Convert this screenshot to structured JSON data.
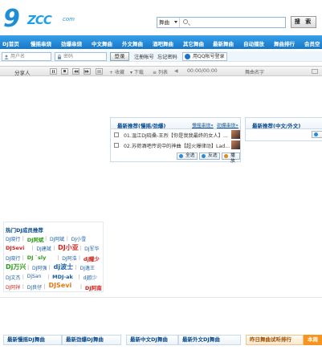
{
  "header": {
    "logo": {
      "mark": "9",
      "name": "ZCC",
      "suffix": "com"
    },
    "search": {
      "category": "舞曲",
      "placeholder": "",
      "button": "搜 索"
    }
  },
  "nav": {
    "items": [
      "DJ首页",
      "慢摇串烧",
      "劲爆串烧",
      "中文舞曲",
      "外文舞曲",
      "酒吧舞曲",
      "其它舞曲",
      "最新舞曲",
      "自动播放",
      "舞曲排行",
      "会员空"
    ]
  },
  "login": {
    "username_placeholder": "用户名",
    "password_placeholder": "密码",
    "login_button": "登录",
    "register": "注册帐号",
    "forgot": "忘记密码",
    "qq_login": "用QQ帐号登录"
  },
  "player": {
    "label": "分享人",
    "buttons": [
      "play",
      "pause",
      "stop",
      "prev",
      "next",
      "loop"
    ],
    "collect": "收藏",
    "download": "下载",
    "list": "列表",
    "time": "00:00/00:00",
    "song_label": "舞曲名字"
  },
  "panel_left": {
    "title": "最新推荐(慢摇/劲爆)",
    "links": [
      "慢摇串烧»",
      "劲爆串烧»"
    ],
    "rows": [
      "01.温江DJ晓桑-王烈【你是我我最终的女人】...",
      "02.苏荷酒吧传说中的神曲【超火爆律动】Lad..."
    ],
    "buttons": [
      "全选",
      "反选",
      "播放"
    ]
  },
  "panel_right": {
    "title": "最新推荐(中文/外文)"
  },
  "dj": {
    "title": "热门DJ成员推荐",
    "tags": [
      {
        "text": "DJ晓行",
        "color": "#1a5ea8",
        "size": 6
      },
      {
        "text": "DJ阿斌",
        "color": "#2e9a1a",
        "size": 6.5,
        "bold": true
      },
      {
        "text": "DJ阿斌",
        "color": "#1a5ea8",
        "size": 6
      },
      {
        "text": "DJ小雪",
        "color": "#1a5ea8",
        "size": 6
      },
      {
        "text": "DJSevi",
        "color": "#d4201a",
        "size": 6.5,
        "bold": true
      },
      {
        "text": "DJ建斌",
        "color": "#1a5ea8",
        "size": 6
      },
      {
        "text": "DJ小亚",
        "color": "#d4201a",
        "size": 8,
        "bold": true
      },
      {
        "text": "DJ军华",
        "color": "#1a5ea8",
        "size": 6
      },
      {
        "text": "DJ晓行",
        "color": "#1a5ea8",
        "size": 6
      },
      {
        "text": "DJ `sly",
        "color": "#2e9a1a",
        "size": 6.5,
        "bold": true
      },
      {
        "text": "DJ阿浩",
        "color": "#1a5ea8",
        "size": 6
      },
      {
        "text": "dj耀少",
        "color": "#d4201a",
        "size": 6.5,
        "bold": true
      },
      {
        "text": "Dj万兴",
        "color": "#2e9a1a",
        "size": 8,
        "bold": true
      },
      {
        "text": "DJ阿强",
        "color": "#1a5ea8",
        "size": 6
      },
      {
        "text": "dj波士",
        "color": "#1a5ea8",
        "size": 8,
        "bold": true
      },
      {
        "text": "DJ逸王",
        "color": "#1a5ea8",
        "size": 6
      },
      {
        "text": "DJ文杰",
        "color": "#1a5ea8",
        "size": 6
      },
      {
        "text": "DjSan",
        "color": "#1a5ea8",
        "size": 6
      },
      {
        "text": "MDJ-ak",
        "color": "#1a5ea8",
        "size": 6.5,
        "bold": true
      },
      {
        "text": "dj欧少",
        "color": "#1a5ea8",
        "size": 6
      },
      {
        "text": "DJ阿祥",
        "color": "#d4201a",
        "size": 6
      },
      {
        "text": "DJ良仔",
        "color": "#1a5ea8",
        "size": 6
      },
      {
        "text": "DJSevi",
        "color": "#e07a1a",
        "size": 8,
        "bold": true
      },
      {
        "text": "DJ阿南",
        "color": "#d4201a",
        "size": 6.5,
        "bold": true
      }
    ]
  },
  "bottom_tabs": [
    "最新慢摇DJ舞曲",
    "最新劲爆DJ舞曲",
    "最新中文DJ舞曲",
    "最新外文DJ舞曲",
    "昨日舞曲试听排行",
    "本周"
  ]
}
